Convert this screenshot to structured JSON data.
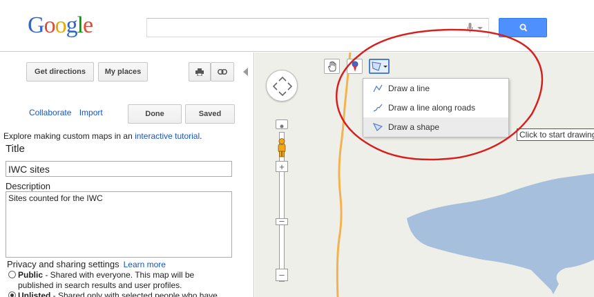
{
  "header": {
    "logo": "Google",
    "search_value": "",
    "icons": {
      "mic": "microphone-icon",
      "search": "search-icon"
    },
    "colors": {
      "search_button": "#4d90fe",
      "logo_blue": "#3366cc",
      "logo_red": "#dd4b39",
      "logo_yellow": "#e6a800",
      "logo_green": "#009900"
    }
  },
  "left_panel": {
    "get_directions": "Get directions",
    "my_places": "My places",
    "collaborate": "Collaborate",
    "import": "Import",
    "done": "Done",
    "saved": "Saved",
    "explore_text": "Explore making custom maps in an",
    "explore_link": "interactive tutorial",
    "explore_end": ".",
    "title_label": "Title",
    "title_value": "IWC sites",
    "description_label": "Description",
    "description_value": "Sites counted for the IWC",
    "privacy_label": "Privacy and sharing settings",
    "learn_more": "Learn more",
    "public_label": "Public",
    "public_desc_1": " - Shared with everyone. This map will be",
    "public_desc_2": "published in search results and user profiles.",
    "unlisted_label": "Unlisted",
    "unlisted_desc": " - Shared only with selected people who have",
    "icons": {
      "print": "print-icon",
      "link": "link-icon",
      "collapse": "collapse-arrow-icon"
    }
  },
  "map": {
    "toolbar_icons": [
      "hand-icon",
      "placemark-icon",
      "shape-icon"
    ],
    "menu": [
      {
        "label": "Draw a line",
        "icon": "line-icon"
      },
      {
        "label": "Draw a line along roads",
        "icon": "road-line-icon"
      },
      {
        "label": "Draw a shape",
        "icon": "shape-icon"
      }
    ],
    "tooltip": "Click to start drawing",
    "colors": {
      "water": "#a5bfdd",
      "road": "#f2b24f",
      "annotation": "#d62020",
      "land": "#efefe9"
    }
  }
}
